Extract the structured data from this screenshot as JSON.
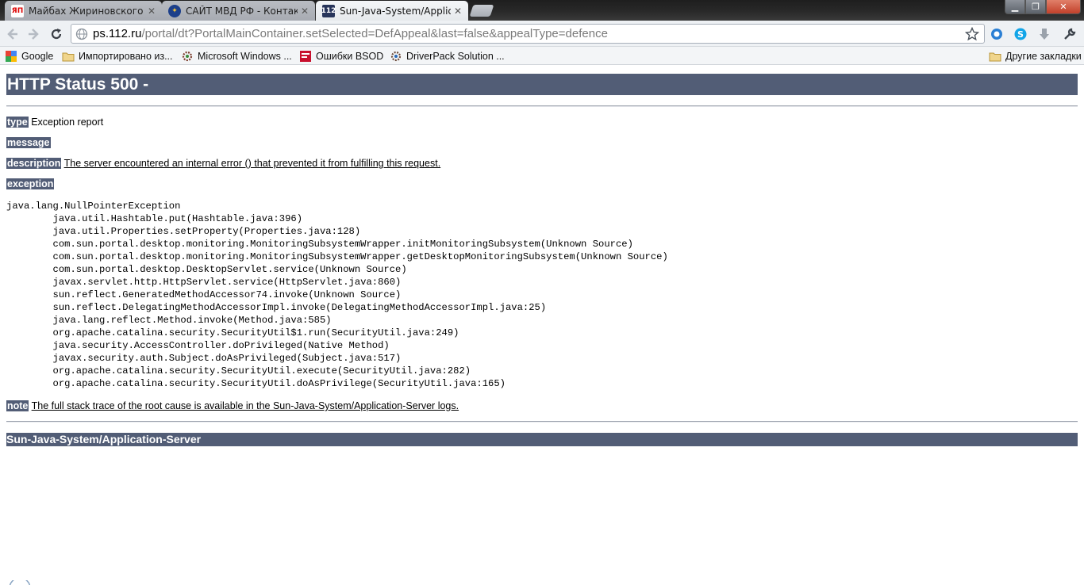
{
  "tabs": [
    {
      "title": "Майбах Жириновского на",
      "favicon": "yandex-ya-icon",
      "active": false
    },
    {
      "title": "САЙТ МВД РФ - Контактна",
      "favicon": "mvd-emblem-icon",
      "active": false
    },
    {
      "title": "Sun-Java-System/Applicatio",
      "favicon": "112-icon",
      "active": true
    }
  ],
  "toolbar": {
    "url_host": "ps.112.ru",
    "url_path": "/portal/dt?PortalMainContainer.setSelected=DefAppeal&last=false&appealType=defence"
  },
  "bookmarks": {
    "items": [
      {
        "label": "Google",
        "icon": "google-icon"
      },
      {
        "label": "Импортировано из...",
        "icon": "folder-icon"
      },
      {
        "label": "Microsoft Windows ...",
        "icon": "windows-gear-icon"
      },
      {
        "label": "Ошибки BSOD",
        "icon": "bsod-icon"
      },
      {
        "label": "DriverPack Solution ...",
        "icon": "driverpack-icon"
      }
    ],
    "other": "Другие закладки"
  },
  "page": {
    "title": "HTTP Status 500 -",
    "type_label": "type",
    "type_value": "Exception report",
    "message_label": "message",
    "description_label": "description",
    "description_value": "The server encountered an internal error () that prevented it from fulfilling this request.",
    "exception_label": "exception",
    "stacktrace": "java.lang.NullPointerException\n\tjava.util.Hashtable.put(Hashtable.java:396)\n\tjava.util.Properties.setProperty(Properties.java:128)\n\tcom.sun.portal.desktop.monitoring.MonitoringSubsystemWrapper.initMonitoringSubsystem(Unknown Source)\n\tcom.sun.portal.desktop.monitoring.MonitoringSubsystemWrapper.getDesktopMonitoringSubsystem(Unknown Source)\n\tcom.sun.portal.desktop.DesktopServlet.service(Unknown Source)\n\tjavax.servlet.http.HttpServlet.service(HttpServlet.java:860)\n\tsun.reflect.GeneratedMethodAccessor74.invoke(Unknown Source)\n\tsun.reflect.DelegatingMethodAccessorImpl.invoke(DelegatingMethodAccessorImpl.java:25)\n\tjava.lang.reflect.Method.invoke(Method.java:585)\n\torg.apache.catalina.security.SecurityUtil$1.run(SecurityUtil.java:249)\n\tjava.security.AccessController.doPrivileged(Native Method)\n\tjavax.security.auth.Subject.doAsPrivileged(Subject.java:517)\n\torg.apache.catalina.security.SecurityUtil.execute(SecurityUtil.java:282)\n\torg.apache.catalina.security.SecurityUtil.doAsPrivilege(SecurityUtil.java:165)",
    "note_label": "note",
    "note_value": "The full stack trace of the root cause is available in the Sun-Java-System/Application-Server logs.",
    "footer": "Sun-Java-System/Application-Server"
  },
  "colors": {
    "tomcat_bar": "#525d76",
    "tab_active": "#eef1f4",
    "tab_inactive": "#aeb2b9"
  }
}
